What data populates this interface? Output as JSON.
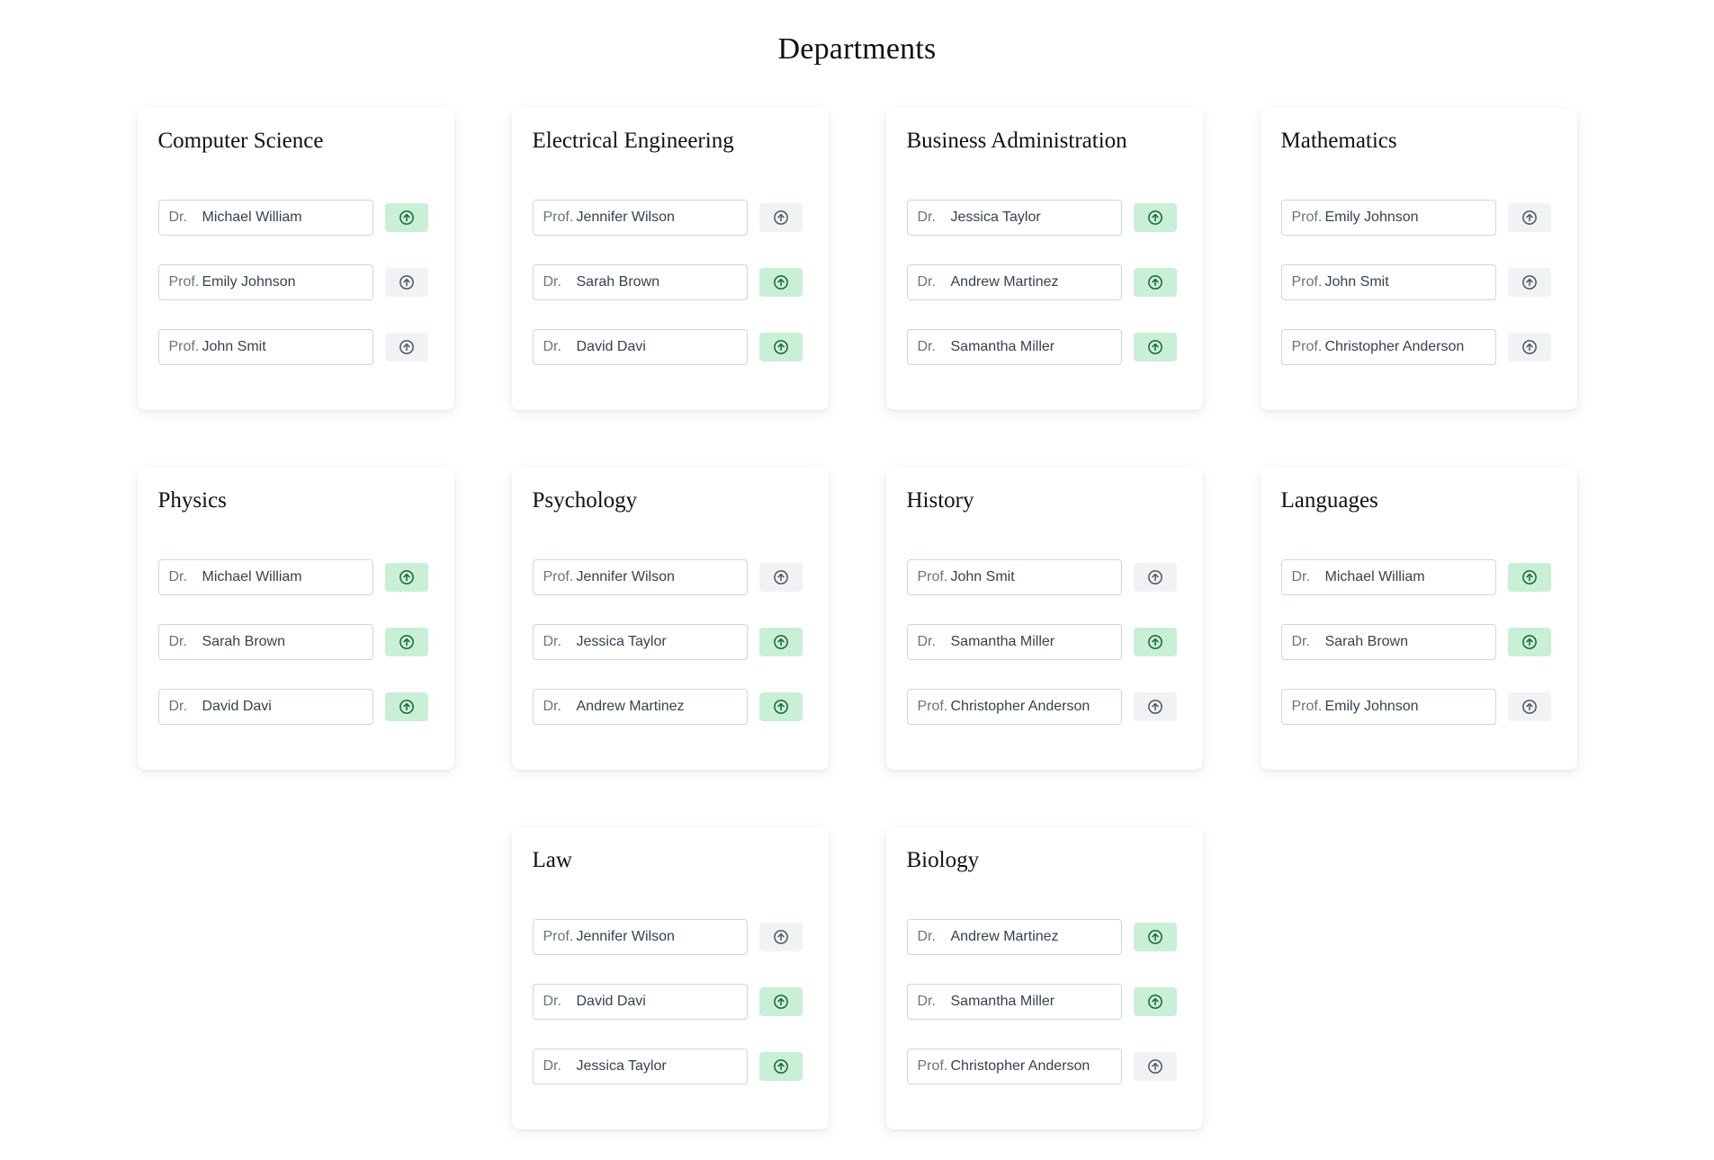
{
  "page": {
    "title": "Departments"
  },
  "colors": {
    "active_bg": "#c9efd6",
    "active_icon": "#166534",
    "inactive_bg": "#f1f2f4",
    "inactive_icon": "#4b5563"
  },
  "departments": [
    {
      "name": "Computer Science",
      "members": [
        {
          "prefix": "Dr.",
          "name": "Michael William",
          "active": true
        },
        {
          "prefix": "Prof.",
          "name": "Emily Johnson",
          "active": false
        },
        {
          "prefix": "Prof.",
          "name": "John Smit",
          "active": false
        }
      ]
    },
    {
      "name": "Electrical Engineering",
      "members": [
        {
          "prefix": "Prof.",
          "name": "Jennifer Wilson",
          "active": false
        },
        {
          "prefix": "Dr.",
          "name": "Sarah Brown",
          "active": true
        },
        {
          "prefix": "Dr.",
          "name": "David Davi",
          "active": true
        }
      ]
    },
    {
      "name": "Business Administration",
      "members": [
        {
          "prefix": "Dr.",
          "name": "Jessica Taylor",
          "active": true
        },
        {
          "prefix": "Dr.",
          "name": "Andrew Martinez",
          "active": true
        },
        {
          "prefix": "Dr.",
          "name": "Samantha Miller",
          "active": true
        }
      ]
    },
    {
      "name": "Mathematics",
      "members": [
        {
          "prefix": "Prof.",
          "name": "Emily Johnson",
          "active": false
        },
        {
          "prefix": "Prof.",
          "name": "John Smit",
          "active": false
        },
        {
          "prefix": "Prof.",
          "name": "Christopher Anderson",
          "active": false
        }
      ]
    },
    {
      "name": "Physics",
      "members": [
        {
          "prefix": "Dr.",
          "name": "Michael William",
          "active": true
        },
        {
          "prefix": "Dr.",
          "name": "Sarah Brown",
          "active": true
        },
        {
          "prefix": "Dr.",
          "name": "David Davi",
          "active": true
        }
      ]
    },
    {
      "name": "Psychology",
      "members": [
        {
          "prefix": "Prof.",
          "name": "Jennifer Wilson",
          "active": false
        },
        {
          "prefix": "Dr.",
          "name": "Jessica Taylor",
          "active": true
        },
        {
          "prefix": "Dr.",
          "name": "Andrew Martinez",
          "active": true
        }
      ]
    },
    {
      "name": "History",
      "members": [
        {
          "prefix": "Prof.",
          "name": "John Smit",
          "active": false
        },
        {
          "prefix": "Dr.",
          "name": "Samantha Miller",
          "active": true
        },
        {
          "prefix": "Prof.",
          "name": "Christopher Anderson",
          "active": false
        }
      ]
    },
    {
      "name": "Languages",
      "members": [
        {
          "prefix": "Dr.",
          "name": "Michael William",
          "active": true
        },
        {
          "prefix": "Dr.",
          "name": "Sarah Brown",
          "active": true
        },
        {
          "prefix": "Prof.",
          "name": "Emily Johnson",
          "active": false
        }
      ]
    },
    {
      "name": "Law",
      "members": [
        {
          "prefix": "Prof.",
          "name": "Jennifer Wilson",
          "active": false
        },
        {
          "prefix": "Dr.",
          "name": "David Davi",
          "active": true
        },
        {
          "prefix": "Dr.",
          "name": "Jessica Taylor",
          "active": true
        }
      ]
    },
    {
      "name": "Biology",
      "members": [
        {
          "prefix": "Dr.",
          "name": "Andrew Martinez",
          "active": true
        },
        {
          "prefix": "Dr.",
          "name": "Samantha Miller",
          "active": true
        },
        {
          "prefix": "Prof.",
          "name": "Christopher Anderson",
          "active": false
        }
      ]
    }
  ]
}
